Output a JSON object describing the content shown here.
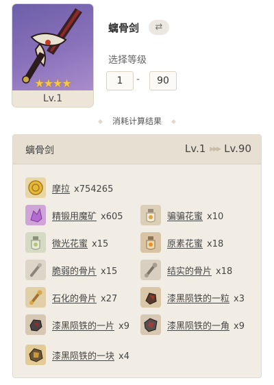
{
  "weapon": {
    "name": "螭骨剑",
    "card_level": "Lv.1",
    "rarity_stars": 4,
    "star_glyph": "★",
    "swap_icon": "⇄"
  },
  "level_select": {
    "label": "选择等级",
    "from": "1",
    "separator": "-",
    "to": "90"
  },
  "section_title": "消耗计算结果",
  "result": {
    "name": "螭骨剑",
    "from_level": "Lv.1",
    "to_level": "Lv.90",
    "arrows_glyph": "▶▶▶"
  },
  "materials": [
    {
      "name": "摩拉",
      "count": "x754265",
      "icon": "mora-coin-icon",
      "bg": "#e8d7a4"
    },
    {
      "name": "精锻用魔矿",
      "count": "x605",
      "icon": "mystic-ore-icon",
      "bg": "#cfa5d9"
    },
    {
      "name": "骗骗花蜜",
      "count": "x10",
      "icon": "nectar-white-icon",
      "bg": "#dccfb8"
    },
    {
      "name": "微光花蜜",
      "count": "x15",
      "icon": "nectar-green-icon",
      "bg": "#d6d9c4"
    },
    {
      "name": "原素花蜜",
      "count": "x18",
      "icon": "nectar-blue-icon",
      "bg": "#d8c4a4"
    },
    {
      "name": "脆弱的骨片",
      "count": "x15",
      "icon": "bone-fragile-icon",
      "bg": "#dcd5c8"
    },
    {
      "name": "结实的骨片",
      "count": "x18",
      "icon": "bone-sturdy-icon",
      "bg": "#d8cfc0"
    },
    {
      "name": "石化的骨片",
      "count": "x27",
      "icon": "bone-fossil-icon",
      "bg": "#e1cfa7"
    },
    {
      "name": "漆黑陨铁的一粒",
      "count": "x3",
      "icon": "meteorite-grain-icon",
      "bg": "#d9c7a8"
    },
    {
      "name": "漆黑陨铁的一片",
      "count": "x9",
      "icon": "meteorite-piece-icon",
      "bg": "#d6c8b2"
    },
    {
      "name": "漆黑陨铁的一角",
      "count": "x9",
      "icon": "meteorite-corner-icon",
      "bg": "#d6c8b2"
    },
    {
      "name": "漆黑陨铁的一块",
      "count": "x4",
      "icon": "meteorite-chunk-icon",
      "bg": "#e2cb96"
    }
  ]
}
